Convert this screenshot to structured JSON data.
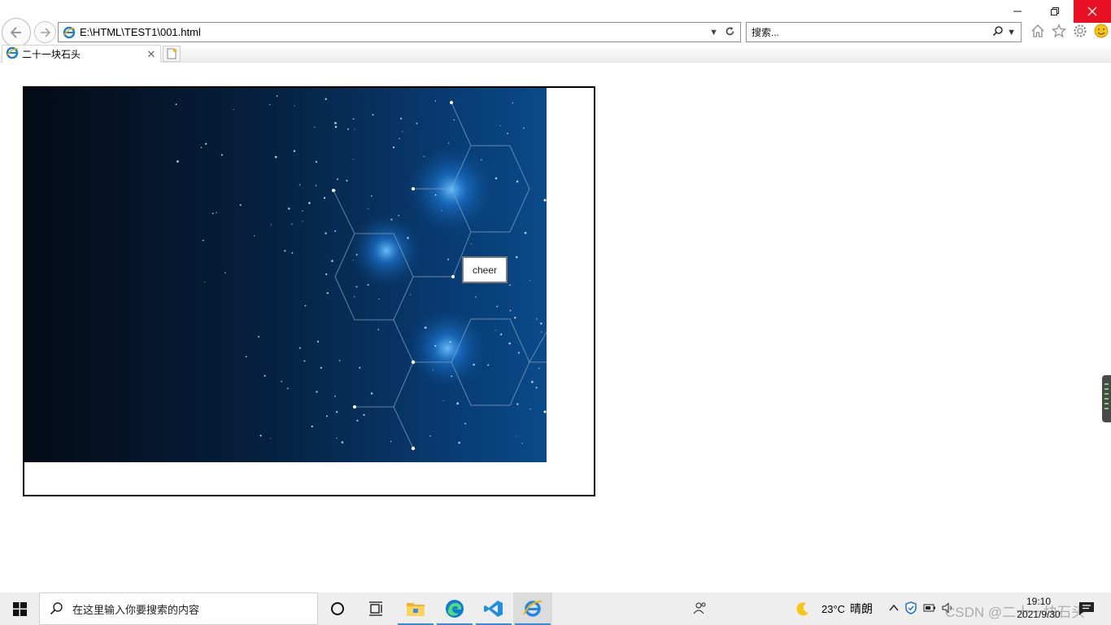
{
  "browser": {
    "address": "E:\\HTML\\TEST1\\001.html",
    "search_placeholder": "搜索...",
    "tab_title": "二十一块石头"
  },
  "page": {
    "tooltip_text": "cheer"
  },
  "taskbar": {
    "search_placeholder": "在这里输入你要搜索的内容",
    "weather_temp": "23°C",
    "weather_desc": "晴朗",
    "time": "19:10",
    "date": "2021/9/30",
    "watermark": "CSDN @二十一块石头"
  },
  "colors": {
    "close_button": "#e81123",
    "taskbar_bg": "#eeeeee",
    "banner_dark": "#030b16",
    "banner_blue": "#0a4a8a"
  }
}
